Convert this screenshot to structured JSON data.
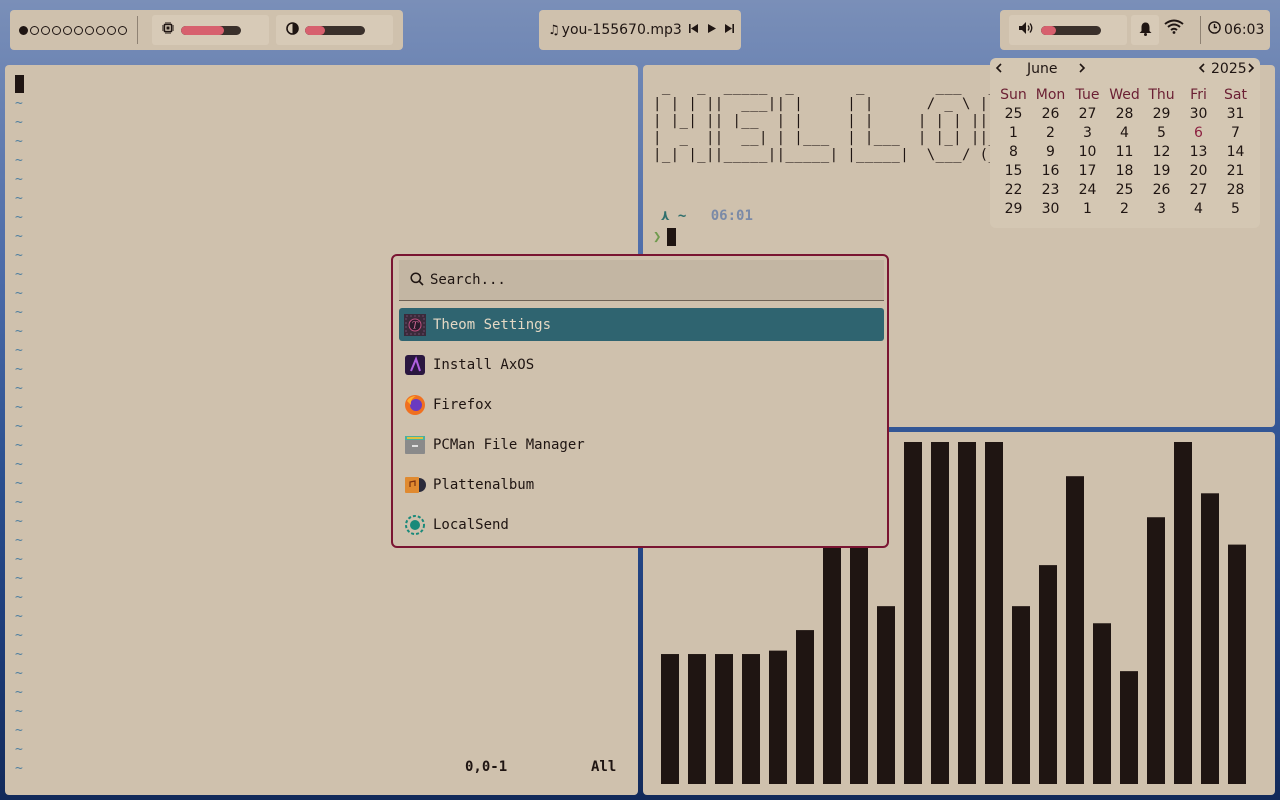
{
  "topbar": {
    "workspaces": [
      {
        "active": true
      },
      {
        "active": false
      },
      {
        "active": false
      },
      {
        "active": false
      },
      {
        "active": false
      },
      {
        "active": false
      },
      {
        "active": false
      },
      {
        "active": false
      },
      {
        "active": false
      },
      {
        "active": false
      }
    ],
    "cpu": {
      "icon": "cpu-icon",
      "level": 0.72
    },
    "memory": {
      "icon": "pie-chart-icon",
      "level": 0.33
    },
    "media": {
      "icon": "music-note-icon",
      "title": "you-155670.mp3",
      "controls": [
        "previous-icon",
        "play-icon",
        "next-icon"
      ]
    },
    "volume": {
      "icon": "speaker-icon",
      "level": 0.25
    },
    "notifications": {
      "icon": "bell-icon"
    },
    "network": {
      "icon": "wifi-icon"
    },
    "clock": {
      "icon": "clock-icon",
      "time": "06:03"
    }
  },
  "vim": {
    "tilde": "~",
    "tilde_count": 36,
    "position": "0,0-1",
    "scroll": "All"
  },
  "terminal": {
    "ascii_art": " _   _  _____  _       _        ___   _ \n| | | ||  ___|| |     | |      / _ \\ | |\n| |_| || |__  | |     | |     | | | || |\n|  _  ||  __| | |___  | |___  | |_| ||_|\n|_| |_||_____||_____| |_____|  \\___/ (_)",
    "prompt_symbol": "⋏",
    "prompt_dir": "~",
    "prompt_time": "06:01",
    "input_symbol": "❯"
  },
  "visualizer": {
    "bar_levels": [
      0.38,
      0.38,
      0.38,
      0.38,
      0.39,
      0.45,
      0.71,
      0.77,
      0.52,
      1.0,
      1.0,
      1.0,
      1.0,
      0.52,
      0.64,
      0.9,
      0.47,
      0.33,
      0.78,
      1.0,
      0.85,
      0.7
    ],
    "bar_color": "#1f1512"
  },
  "calendar": {
    "month": "June",
    "year": "2025",
    "weekdays": [
      "Sun",
      "Mon",
      "Tue",
      "Wed",
      "Thu",
      "Fri",
      "Sat"
    ],
    "days": [
      [
        "25",
        "26",
        "27",
        "28",
        "29",
        "30",
        "31"
      ],
      [
        "1",
        "2",
        "3",
        "4",
        "5",
        "6",
        "7"
      ],
      [
        "8",
        "9",
        "10",
        "11",
        "12",
        "13",
        "14"
      ],
      [
        "15",
        "16",
        "17",
        "18",
        "19",
        "20",
        "21"
      ],
      [
        "22",
        "23",
        "24",
        "25",
        "26",
        "27",
        "28"
      ],
      [
        "29",
        "30",
        "1",
        "2",
        "3",
        "4",
        "5"
      ]
    ],
    "highlighted_day": "6",
    "prev_icon": "chevron-left-icon",
    "next_icon": "chevron-right-icon"
  },
  "launcher": {
    "search_placeholder": "Search...",
    "search_icon": "search-icon",
    "apps": [
      {
        "label": "Theom Settings",
        "icon": "theom-settings-icon",
        "selected": true
      },
      {
        "label": "Install AxOS",
        "icon": "axos-installer-icon",
        "selected": false
      },
      {
        "label": "Firefox",
        "icon": "firefox-icon",
        "selected": false
      },
      {
        "label": "PCMan File Manager",
        "icon": "file-manager-icon",
        "selected": false
      },
      {
        "label": "Plattenalbum",
        "icon": "plattenalbum-icon",
        "selected": false
      },
      {
        "label": "LocalSend",
        "icon": "localsend-icon",
        "selected": false
      }
    ]
  },
  "colors": {
    "panel_bg": "#cfc1ad",
    "accent_red": "#d7606e",
    "selection": "#2f6470",
    "launcher_border": "#7a1532",
    "text": "#1f1512"
  }
}
